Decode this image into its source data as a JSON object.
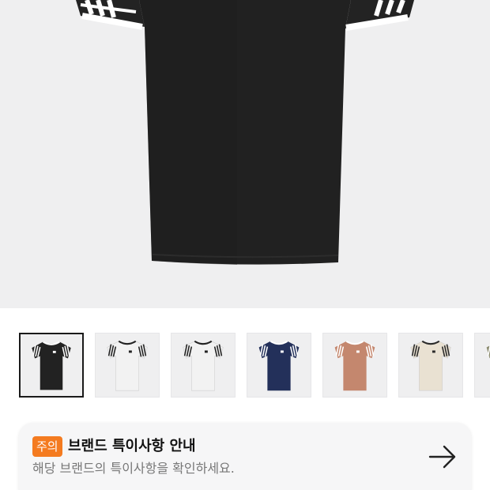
{
  "hero": {
    "icon": "black-tshirt-photo",
    "shirt_color": "#212121",
    "stripe_color": "#ffffff"
  },
  "thumbnails": [
    {
      "icon": "black-tshirt-thumb",
      "body": "#222222",
      "trim": "#ffffff",
      "selected": true
    },
    {
      "icon": "white-tshirt-thumb",
      "body": "#f2f2f2",
      "trim": "#222222",
      "selected": false
    },
    {
      "icon": "white-tshirt-thumb",
      "body": "#f2f2f2",
      "trim": "#222222",
      "selected": false
    },
    {
      "icon": "navy-tshirt-thumb",
      "body": "#23305a",
      "trim": "#ffffff",
      "selected": false
    },
    {
      "icon": "tan-tshirt-thumb",
      "body": "#c4876e",
      "trim": "#ffffff",
      "selected": false
    },
    {
      "icon": "cream-tshirt-thumb",
      "body": "#e9e1d2",
      "trim": "#2a2a2a",
      "selected": false
    },
    {
      "icon": "olive-tshirt-thumb",
      "body": "#8a8a6e",
      "trim": "#ffffff",
      "selected": false
    }
  ],
  "notice": {
    "badge": "주의",
    "title": "브랜드 특이사항 안내",
    "subtitle": "해당 브랜드의 특이사항을 확인하세요.",
    "arrow_icon": "arrow-right-icon",
    "badge_color": "#f47b20"
  }
}
